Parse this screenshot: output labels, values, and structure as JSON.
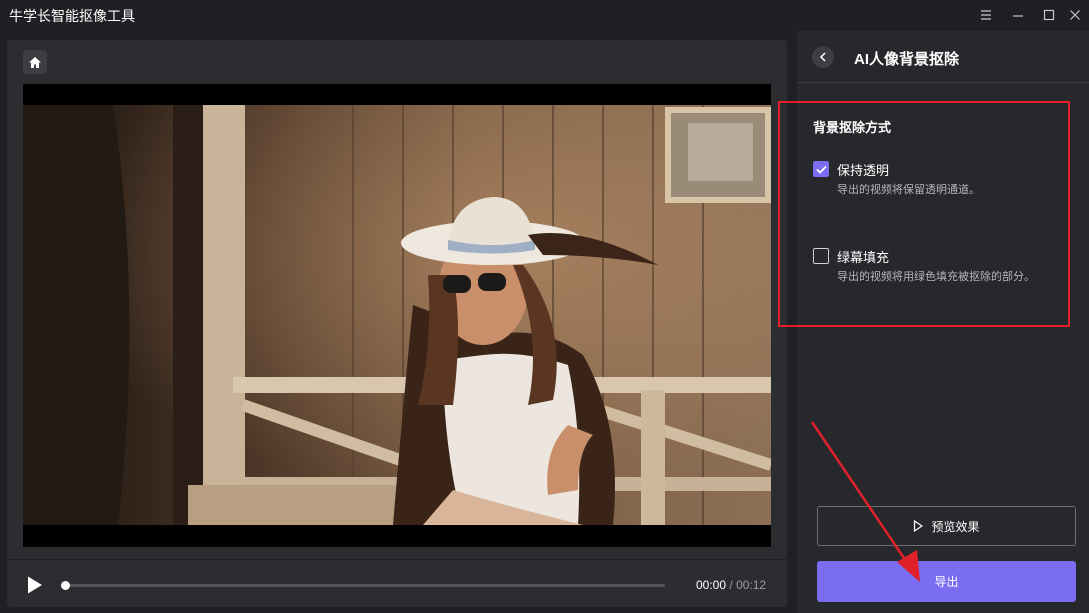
{
  "app": {
    "title": "牛学长智能抠像工具"
  },
  "window_controls": [
    "menu-icon",
    "minimize-icon",
    "maximize-icon",
    "close-icon"
  ],
  "player": {
    "current_time": "00:00",
    "separator": "/",
    "total_time": "00:12",
    "progress": 0
  },
  "panel": {
    "title": "AI人像背景抠除",
    "section_title": "背景抠除方式",
    "options": [
      {
        "label": "保持透明",
        "description": "导出的视频将保留透明通道。",
        "checked": true
      },
      {
        "label": "绿幕填充",
        "description": "导出的视频将用绿色填充被抠除的部分。",
        "checked": false
      }
    ],
    "preview_label": "预览效果",
    "export_label": "导出"
  },
  "colors": {
    "accent": "#7b6df2",
    "annotation": "#e0212a",
    "background": "#1f2023",
    "panel": "#27282c"
  }
}
